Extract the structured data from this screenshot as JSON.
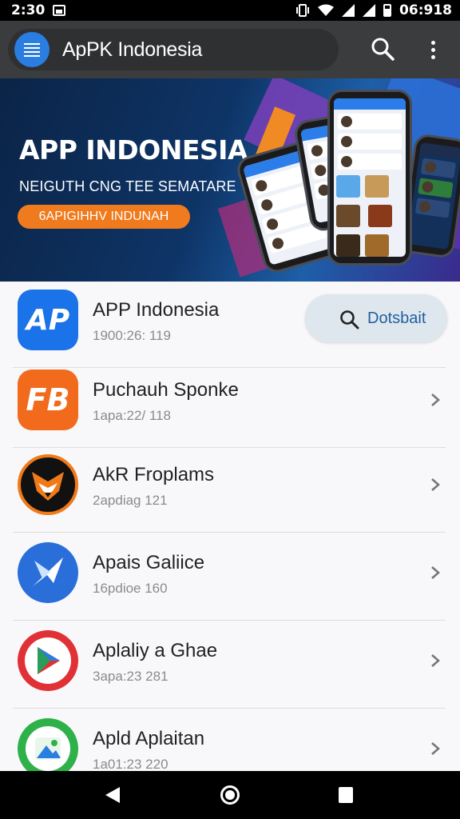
{
  "status_bar": {
    "time": "2:30",
    "clock": "06:918"
  },
  "app_bar": {
    "title": "ApPK Indonesia",
    "icons": [
      "menu-icon",
      "search-icon",
      "more-vert-icon"
    ],
    "accent_color": "#2a7de1"
  },
  "banner": {
    "title": "APP INDONESIA",
    "subtitle": "NEIGUTH CNG TEE SEMATARE",
    "cta_label": "6APIGIHHV INDUNAH",
    "cta_color": "#ef7b1e"
  },
  "download_button": {
    "label": "Dotsbait",
    "icon": "search-icon"
  },
  "apps": [
    {
      "name": "APP Indonesia",
      "meta": "1900:26: 119",
      "icon_text": "AP",
      "icon_color": "#1a73e8",
      "icon": "ap-logo-icon"
    },
    {
      "name": "Puchauh Sponke",
      "meta": "1apa:22/ 118",
      "icon_text": "FB",
      "icon_color": "#f26b1d",
      "icon": "fb-logo-icon"
    },
    {
      "name": "AkR Froplams",
      "meta": "2apdiag 121",
      "icon_text": "",
      "icon_color": "#111111",
      "icon": "fox-logo-icon"
    },
    {
      "name": "Apais Galiice",
      "meta": "16pdioe 160",
      "icon_text": "",
      "icon_color": "#2a6fd9",
      "icon": "plane-logo-icon"
    },
    {
      "name": "Aplaliy a Ghae",
      "meta": "3apa:23 281",
      "icon_text": "",
      "icon_color": "#e03236",
      "icon": "play-logo-icon"
    },
    {
      "name": "Apld Aplaitan",
      "meta": "1a01:23 220",
      "icon_text": "",
      "icon_color": "#2fb14a",
      "icon": "image-logo-icon"
    }
  ],
  "nav_bar": {
    "icons": [
      "back-icon",
      "home-icon",
      "recents-icon"
    ]
  }
}
